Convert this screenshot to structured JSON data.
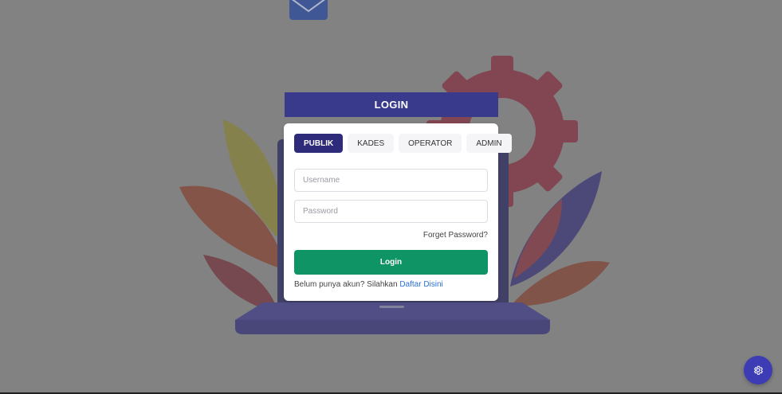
{
  "header": {
    "title": "LOGIN"
  },
  "tabs": [
    {
      "label": "PUBLIK",
      "active": true
    },
    {
      "label": "KADES",
      "active": false
    },
    {
      "label": "OPERATOR",
      "active": false
    },
    {
      "label": "ADMIN",
      "active": false
    }
  ],
  "form": {
    "username_placeholder": "Username",
    "username_value": "",
    "password_placeholder": "Password",
    "password_value": "",
    "forget_label": "Forget Password?",
    "login_label": "Login",
    "signup_text": "Belum punya akun? Silahkan",
    "signup_link": "Daftar Disini"
  },
  "fab": {
    "icon": "gear-icon"
  },
  "colors": {
    "header_bg": "#3a3a8c",
    "active_tab": "#2e2b7a",
    "login_button": "#0f9466",
    "link": "#2a6fd6",
    "fab": "#3e3cb5"
  }
}
